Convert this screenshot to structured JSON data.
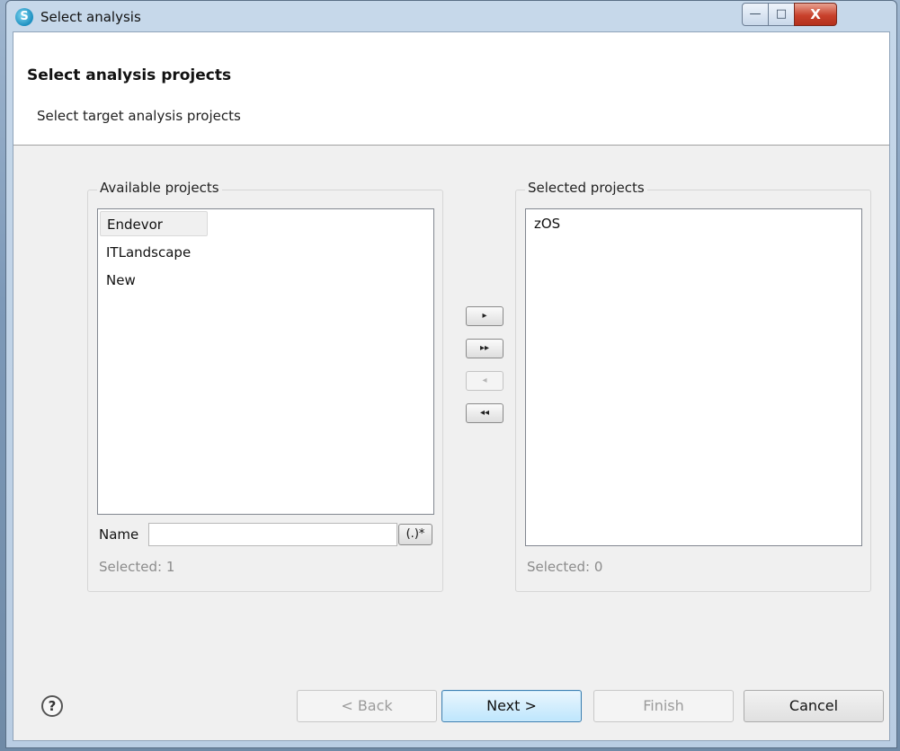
{
  "window": {
    "title": "Select analysis",
    "icon": "app-logo-icon",
    "controls": {
      "minimize": "—",
      "maximize": "□",
      "close": "X"
    }
  },
  "header": {
    "title": "Select analysis projects",
    "subtitle": "Select target analysis projects"
  },
  "available": {
    "label": "Available projects",
    "items": [
      "Endevor",
      "ITLandscape",
      "New"
    ],
    "selected_item": "Endevor",
    "filter_label": "Name",
    "filter_value": "",
    "regex_button": "(.)*",
    "count_text": "Selected: 1"
  },
  "selected": {
    "label": "Selected projects",
    "items": [
      "zOS"
    ],
    "count_text": "Selected: 0"
  },
  "move_buttons": {
    "add": "▸",
    "add_all": "▸▸",
    "remove": "◂",
    "remove_all": "◂◂"
  },
  "footer": {
    "help_icon": "?",
    "back": "< Back",
    "next": "Next >",
    "finish": "Finish",
    "cancel": "Cancel"
  }
}
